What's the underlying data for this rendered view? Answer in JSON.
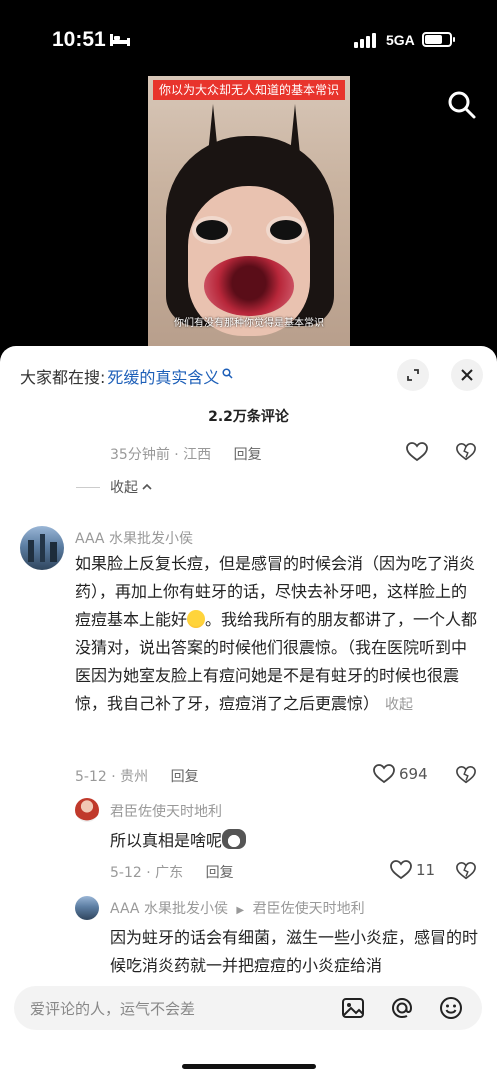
{
  "status_bar": {
    "time": "10:51",
    "network": "5GA"
  },
  "video": {
    "banner": "你以为大众却无人知道的基本常识",
    "subtitle": "你们有没有那种你觉得是基本常识"
  },
  "sheet": {
    "search_label": "大家都在搜:",
    "search_term": "死缓的真实含义",
    "comment_count": "2.2万条评论"
  },
  "prev_comment": {
    "meta": "35分钟前 · 江西",
    "reply": "回复",
    "collapse": "收起"
  },
  "comment": {
    "user": "AAA 水果批发小侯",
    "text_1": "如果脸上反复长痘，但是感冒的时候会消（因为吃了消炎药），再加上你有蛀牙的话，尽快去补牙吧，这样脸上的痘痘基本上能好",
    "text_2": "。我给我所有的朋友都讲了，一个人都没猜对，说出答案的时候他们很震惊。（我在医院听到中医因为她室友脸上有痘问她是不是有蛀牙的时候也很震惊，我自己补了牙，痘痘消了之后更震惊）",
    "fold": "收起",
    "meta": "5-12 · 贵州",
    "reply": "回复",
    "likes": "694"
  },
  "reply_1": {
    "user": "君臣佐使天时地利",
    "text": "所以真相是啥呢",
    "meta": "5-12 · 广东",
    "reply": "回复",
    "likes": "11"
  },
  "reply_2": {
    "user": "AAA 水果批发小侯",
    "to_user": "君臣佐使天时地利",
    "text": "因为蛀牙的话会有细菌，滋生一些小炎症，感冒的时候吃消炎药就一并把痘痘的小炎症给消"
  },
  "input": {
    "placeholder": "爱评论的人，运气不会差"
  },
  "colors": {
    "accent_link": "#1d5fb8",
    "banner_red": "#e8342c"
  }
}
